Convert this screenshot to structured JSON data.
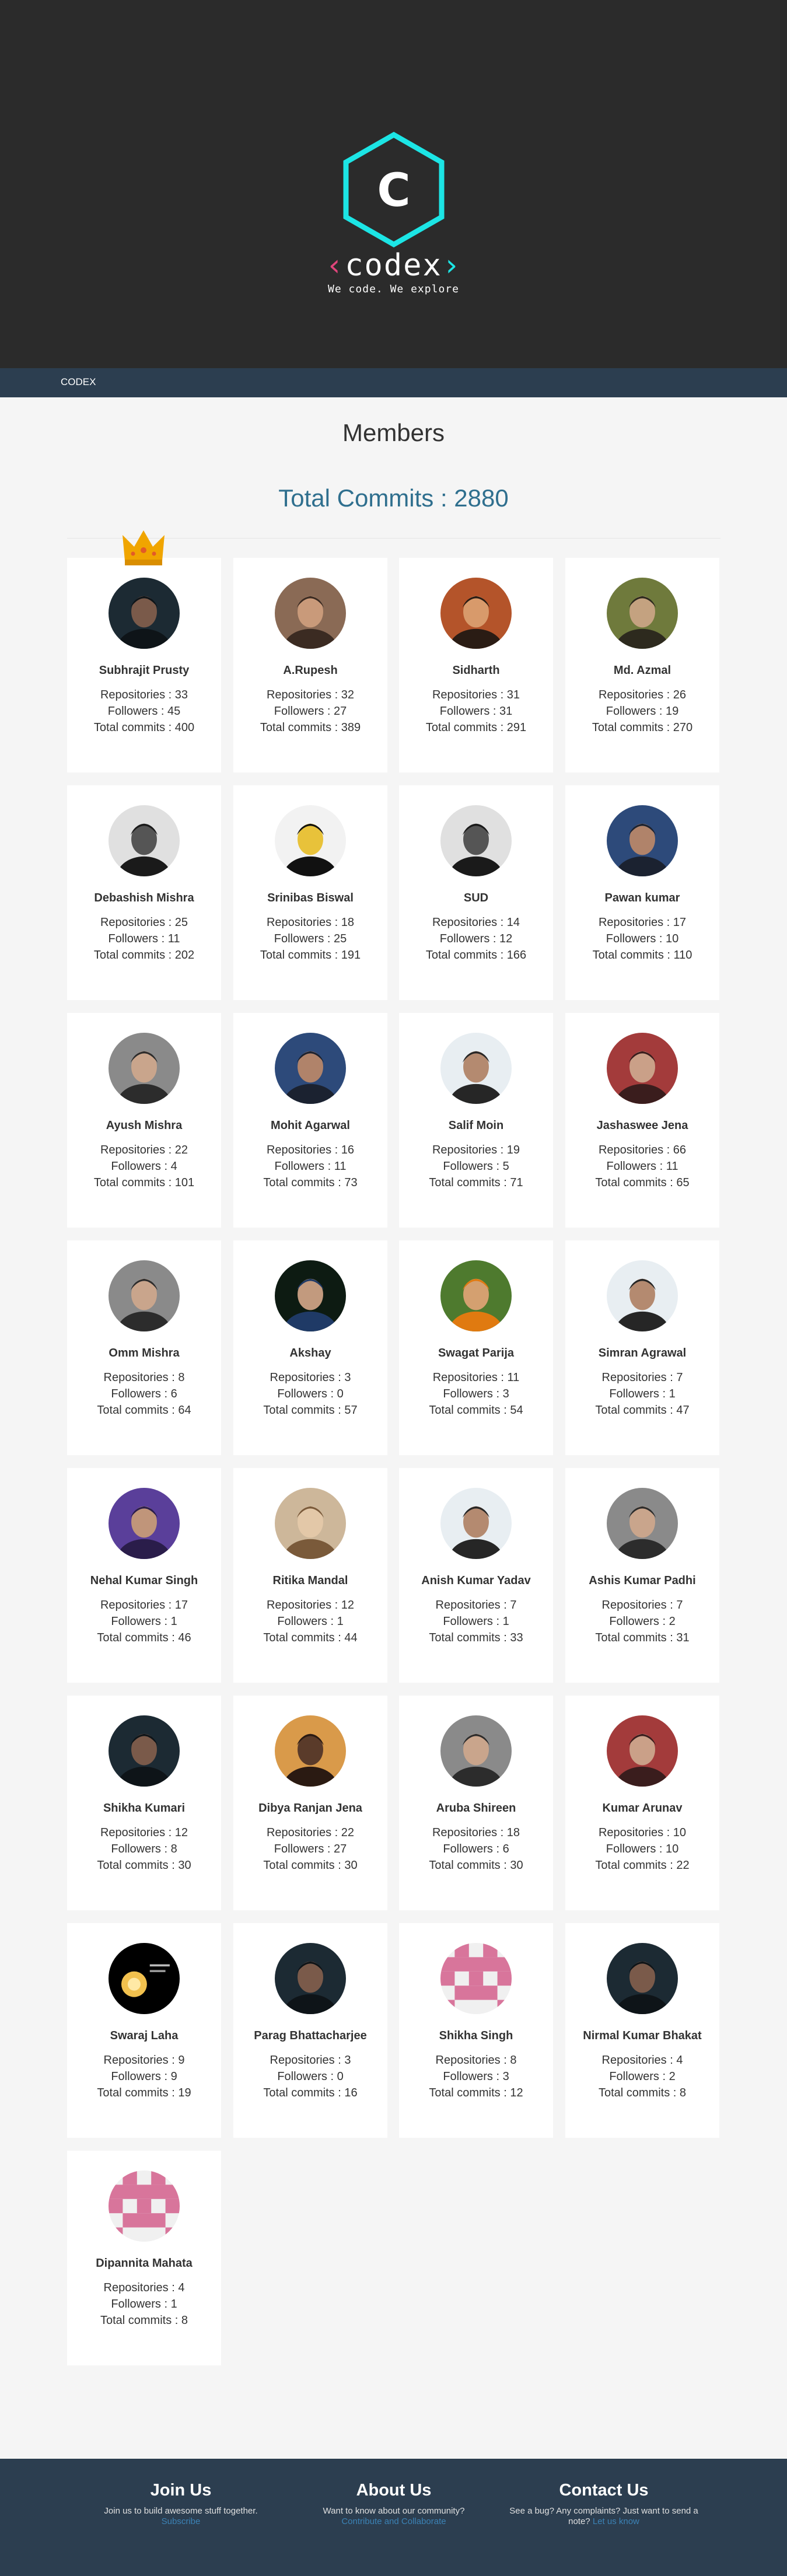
{
  "header": {
    "logo_letter": "C",
    "logo_word": "codex",
    "tagline": "We code. We explore"
  },
  "navbar": {
    "brand": "CODEX"
  },
  "page": {
    "title": "Members",
    "total_commits": "Total Commits : 2880"
  },
  "labels": {
    "repositories": "Repositories : ",
    "followers": "Followers : ",
    "total_commits": "Total commits : "
  },
  "members": [
    {
      "name": "Subhrajit Prusty",
      "repos": 33,
      "followers": 45,
      "commits": 400,
      "avatar": "dark-portrait"
    },
    {
      "name": "A.Rupesh",
      "repos": 32,
      "followers": 27,
      "commits": 389,
      "avatar": "brown-portrait"
    },
    {
      "name": "Sidharth",
      "repos": 31,
      "followers": 31,
      "commits": 291,
      "avatar": "warm-portrait"
    },
    {
      "name": "Md. Azmal",
      "repos": 26,
      "followers": 19,
      "commits": 270,
      "avatar": "green-portrait"
    },
    {
      "name": "Debashish Mishra",
      "repos": 25,
      "followers": 11,
      "commits": 202,
      "avatar": "bw-portrait"
    },
    {
      "name": "Srinibas Biswal",
      "repos": 18,
      "followers": 25,
      "commits": 191,
      "avatar": "comic-portrait"
    },
    {
      "name": "SUD",
      "repos": 14,
      "followers": 12,
      "commits": 166,
      "avatar": "bw-portrait"
    },
    {
      "name": "Pawan kumar",
      "repos": 17,
      "followers": 10,
      "commits": 110,
      "avatar": "blue-portrait"
    },
    {
      "name": "Ayush Mishra",
      "repos": 22,
      "followers": 4,
      "commits": 101,
      "avatar": "gray-portrait"
    },
    {
      "name": "Mohit Agarwal",
      "repos": 16,
      "followers": 11,
      "commits": 73,
      "avatar": "blue-portrait"
    },
    {
      "name": "Salif Moin",
      "repos": 19,
      "followers": 5,
      "commits": 71,
      "avatar": "light-portrait"
    },
    {
      "name": "Jashaswee Jena",
      "repos": 66,
      "followers": 11,
      "commits": 65,
      "avatar": "red-portrait"
    },
    {
      "name": "Omm Mishra",
      "repos": 8,
      "followers": 6,
      "commits": 64,
      "avatar": "gray-portrait"
    },
    {
      "name": "Akshay",
      "repos": 3,
      "followers": 0,
      "commits": 57,
      "avatar": "check-portrait"
    },
    {
      "name": "Swagat Parija",
      "repos": 11,
      "followers": 3,
      "commits": 54,
      "avatar": "orange-portrait"
    },
    {
      "name": "Simran Agrawal",
      "repos": 7,
      "followers": 1,
      "commits": 47,
      "avatar": "light-portrait"
    },
    {
      "name": "Nehal Kumar Singh",
      "repos": 17,
      "followers": 1,
      "commits": 46,
      "avatar": "purple-portrait"
    },
    {
      "name": "Ritika Mandal",
      "repos": 12,
      "followers": 1,
      "commits": 44,
      "avatar": "tan-portrait"
    },
    {
      "name": "Anish Kumar Yadav",
      "repos": 7,
      "followers": 1,
      "commits": 33,
      "avatar": "light-portrait"
    },
    {
      "name": "Ashis Kumar Padhi",
      "repos": 7,
      "followers": 2,
      "commits": 31,
      "avatar": "gray-portrait"
    },
    {
      "name": "Shikha Kumari",
      "repos": 12,
      "followers": 8,
      "commits": 30,
      "avatar": "dark-portrait"
    },
    {
      "name": "Dibya Ranjan Jena",
      "repos": 22,
      "followers": 27,
      "commits": 30,
      "avatar": "sunset-portrait"
    },
    {
      "name": "Aruba Shireen",
      "repos": 18,
      "followers": 6,
      "commits": 30,
      "avatar": "gray-portrait"
    },
    {
      "name": "Kumar Arunav",
      "repos": 10,
      "followers": 10,
      "commits": 22,
      "avatar": "red-portrait"
    },
    {
      "name": "Swaraj Laha",
      "repos": 9,
      "followers": 9,
      "commits": 19,
      "avatar": "bulb-portrait"
    },
    {
      "name": "Parag Bhattacharjee",
      "repos": 3,
      "followers": 0,
      "commits": 16,
      "avatar": "dark-portrait"
    },
    {
      "name": "Shikha Singh",
      "repos": 8,
      "followers": 3,
      "commits": 12,
      "avatar": "identicon"
    },
    {
      "name": "Nirmal Kumar Bhakat",
      "repos": 4,
      "followers": 2,
      "commits": 8,
      "avatar": "dark-portrait"
    },
    {
      "name": "Dipannita Mahata",
      "repos": 4,
      "followers": 1,
      "commits": 8,
      "avatar": "identicon"
    }
  ],
  "footer": {
    "join": {
      "title": "Join Us",
      "text": "Join us to build awesome stuff together.",
      "link": "Subscribe"
    },
    "about": {
      "title": "About Us",
      "text": "Want to know about our community?",
      "link": "Contribute and Collaborate"
    },
    "contact": {
      "title": "Contact Us",
      "text": "See a bug? Any complaints? Just want to send a note?",
      "link": "Let us know"
    }
  },
  "colors": {
    "hero_bg": "#2b2b2b",
    "accent_cyan": "#1ce5e5",
    "accent_pink": "#e0457b",
    "navbar_bg": "#2c3e50",
    "total_text": "#2f6f8e",
    "crown": "#f0a500",
    "link": "#3b82b5"
  }
}
